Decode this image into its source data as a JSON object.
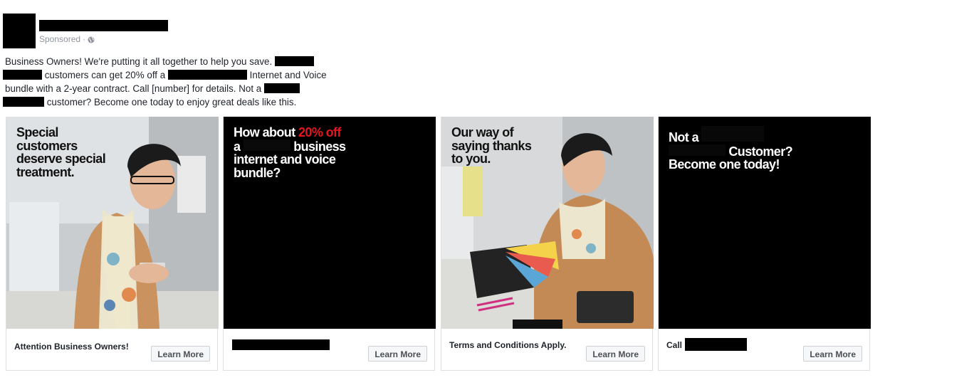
{
  "post": {
    "sponsored_label": "Sponsored",
    "meta_separator": "·",
    "text": {
      "l1a": "Business Owners! We're putting it all together to help you save.",
      "l2a": "customers can get 20% off a",
      "l2b": "Internet and Voice",
      "l3": "bundle with a 2-year contract. Call [number] for details. Not a",
      "l4": "customer? Become one today to enjoy great deals like this."
    }
  },
  "cards": [
    {
      "headline": [
        "Special",
        "customers",
        "deserve special",
        "treatment."
      ],
      "footer_text": "Attention Business Owners!",
      "button_label": "Learn More"
    },
    {
      "headline_a": "How about ",
      "headline_red": "20% off",
      "headline_b": "a",
      "headline_c": "business",
      "headline_d": "internet and voice",
      "headline_e": "bundle?",
      "footer_text": "",
      "button_label": "Learn More"
    },
    {
      "headline": [
        "Our way of",
        "saying thanks",
        "to you."
      ],
      "footer_text": "Terms and Conditions Apply.",
      "button_label": "Learn More"
    },
    {
      "headline_a": "Not a",
      "headline_b": "Customer?",
      "headline_c": "Become one today!",
      "footer_text": "Call",
      "button_label": "Learn More"
    }
  ],
  "icons": {
    "globe": "globe-icon"
  },
  "colors": {
    "accent_red": "#e4151f",
    "muted": "#90949c"
  }
}
